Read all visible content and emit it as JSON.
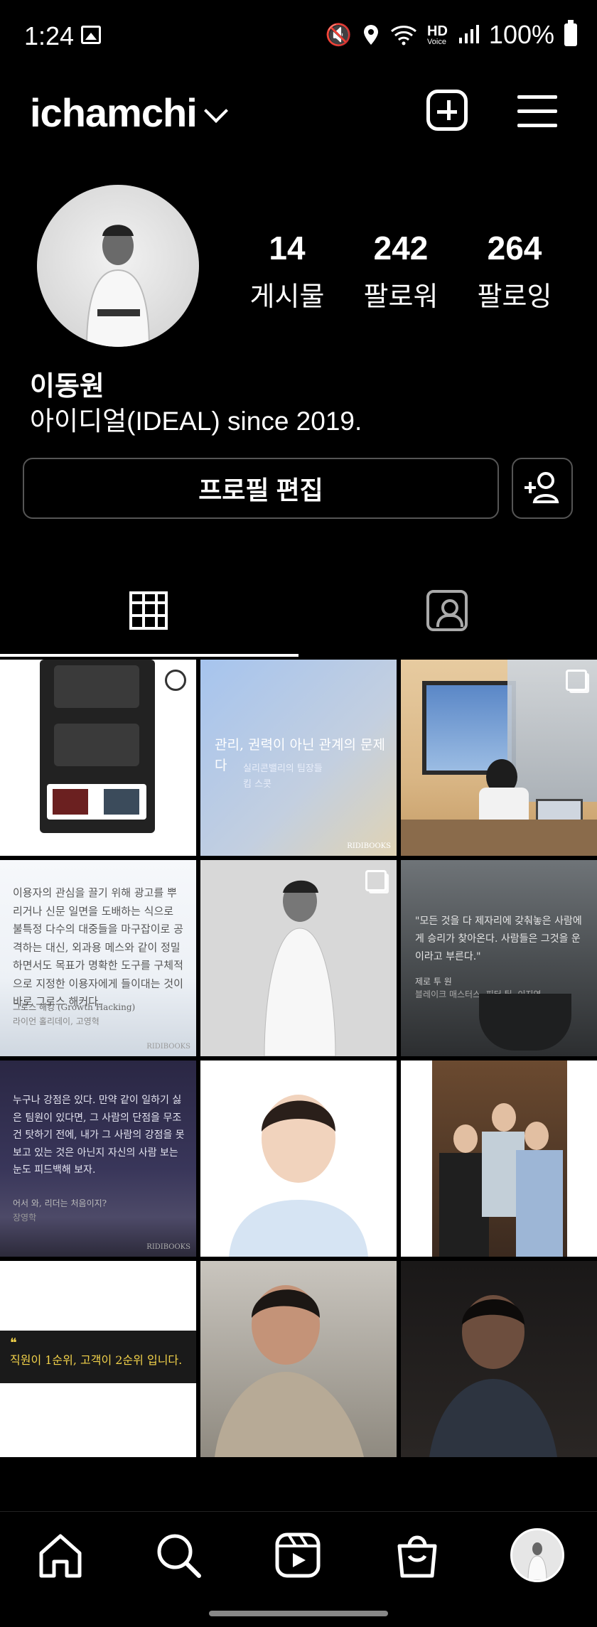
{
  "status_bar": {
    "time": "1:24",
    "icons": [
      "gallery-icon",
      "mute-vibrate-icon",
      "location-icon",
      "wifi-calling-icon",
      "hd-voice-icon",
      "signal-icon"
    ],
    "hd": "HD",
    "voice": "Voice",
    "battery": "100%"
  },
  "header": {
    "username": "ichamchi",
    "icons": [
      "chevron-down-icon",
      "add-post-icon",
      "menu-icon"
    ]
  },
  "profile": {
    "posts_count": "14",
    "posts_label": "게시물",
    "followers_count": "242",
    "followers_label": "팔로워",
    "following_count": "264",
    "following_label": "팔로잉",
    "name": "이동원",
    "bio": "아이디얼(IDEAL) since 2019.",
    "edit_profile_label": "프로필 편집"
  },
  "tabs": [
    "grid-icon",
    "tagged-icon"
  ],
  "posts": {
    "p2_title": "관리, 권력이 아닌 관계의 문제다",
    "p2_sub1": "실리콘밸리의 팀장들",
    "p2_sub2": "킴 스콧",
    "p4_quote": "이용자의 관심을 끌기 위해 광고를 뿌리거나 신문 일면을 도배하는 식으로 불특정 다수의 대중들을 마구잡이로 공격하는 대신, 외과용 메스와 같이 정밀하면서도 목표가 명확한 도구를 구체적으로 지정한 이용자에게 들이대는 것이 바로 그로스 해커다.",
    "p4_book": "그로스 해킹 (Growth Hacking)",
    "p4_author": "라이언 홀리데이, 고영혁",
    "p6_quote": "\"모든 것을 다 제자리에 갖춰놓은 사람에게 승리가 찾아온다. 사람들은 그것을 운이라고 부른다.\"",
    "p6_book": "제로 투 원",
    "p6_author": "블레이크 매스터스, 피터 틸, 이지연",
    "p7_quote": "누구나 강점은 있다. 만약 같이 일하기 싫은 팀원이 있다면, 그 사람의 단점을 무조건 탓하기 전에, 내가 그 사람의 강점을 못 보고 있는 것은 아닌지 자신의 사람 보는 눈도 피드백해 보자.",
    "p7_book": "어서 와, 리더는 처음이지?",
    "p7_author": "장영학",
    "p10_quote": "직원이 1순위, 고객이 2순위 입니다.",
    "ridi": "RIDIBOOKS"
  },
  "navbar": [
    "home-icon",
    "search-icon",
    "reels-icon",
    "shop-icon",
    "profile-avatar"
  ]
}
